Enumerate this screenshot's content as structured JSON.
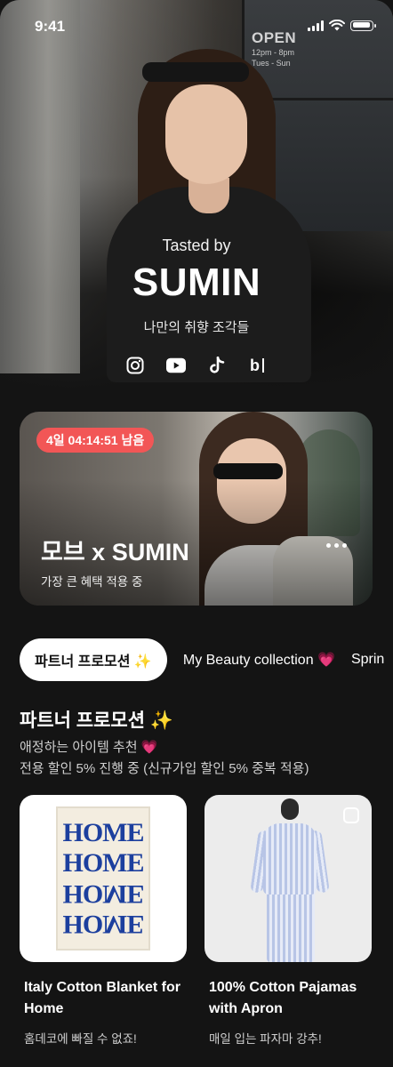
{
  "status_bar": {
    "time": "9:41"
  },
  "hero": {
    "sign_open": "OPEN",
    "sign_hours_1": "12pm - 8pm",
    "sign_hours_2": "Tues - Sun",
    "tasted_by": "Tasted by",
    "creator_name": "SUMIN",
    "tagline": "나만의 취향 조각들",
    "socials": [
      "instagram-icon",
      "youtube-icon",
      "tiktok-icon",
      "blog-icon"
    ]
  },
  "promo_card": {
    "countdown": "4일 04:14:51 남음",
    "title": "모브 x SUMIN",
    "subtitle": "가장 큰 혜택 적용 중"
  },
  "tabs": [
    {
      "label": "파트너 프로모션 ✨",
      "active": true
    },
    {
      "label": "My Beauty collection 💗",
      "active": false
    },
    {
      "label": "Sprin",
      "active": false
    }
  ],
  "section": {
    "title": "파트너 프로모션 ✨",
    "desc_line1": "애정하는 아이템 추천 💗",
    "desc_line2": "전용 할인 5% 진행 중 (신규가입 할인 5% 중복 적용)"
  },
  "products": [
    {
      "name": "Italy Cotton Blanket for Home",
      "desc": "홈데코에 빠질 수 없죠!",
      "image_word": "HOME"
    },
    {
      "name": "100% Cotton Pajamas with Apron",
      "desc": "매일 입는 파자마 강추!"
    }
  ],
  "colors": {
    "background": "#141414",
    "countdown_badge": "#f25656",
    "active_tab_bg": "#ffffff"
  }
}
